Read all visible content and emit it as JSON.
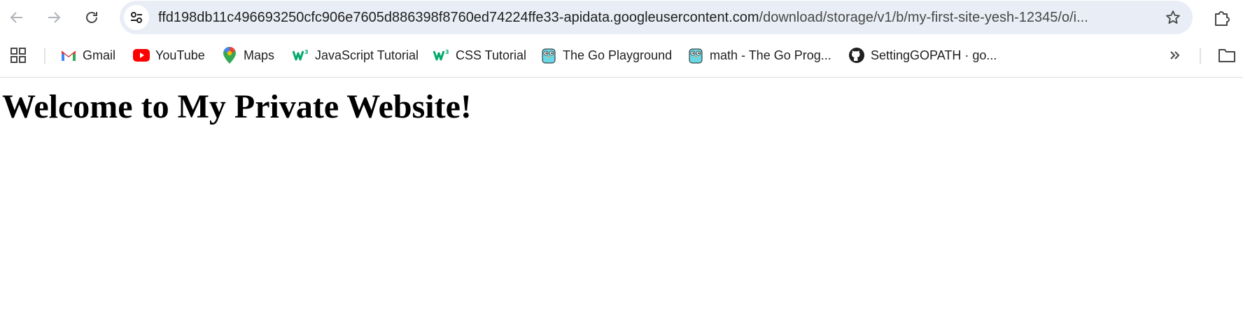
{
  "browser": {
    "url_host": "ffd198db11c496693250cfc906e7605d886398f8760ed74224ffe33-apidata.googleusercontent.com",
    "url_path": "/download/storage/v1/b/my-first-site-yesh-12345/o/i...",
    "icons": {
      "back": "arrow-left",
      "forward": "arrow-right",
      "reload": "reload",
      "site_info": "tune",
      "bookmark": "star",
      "extensions": "puzzle-piece"
    }
  },
  "bookmarks_bar": {
    "items": [
      {
        "label": "Gmail",
        "icon": "gmail"
      },
      {
        "label": "YouTube",
        "icon": "youtube"
      },
      {
        "label": "Maps",
        "icon": "maps-pin"
      },
      {
        "label": "JavaScript Tutorial",
        "icon": "w3schools"
      },
      {
        "label": "CSS Tutorial",
        "icon": "w3schools"
      },
      {
        "label": "The Go Playground",
        "icon": "go-gopher"
      },
      {
        "label": "math - The Go Prog...",
        "icon": "go-gopher"
      },
      {
        "label": "SettingGOPATH · go...",
        "icon": "github"
      }
    ],
    "more_icon": "double-chevron-right",
    "folder_icon": "folder"
  },
  "page": {
    "heading": "Welcome to My Private Website!"
  },
  "colors": {
    "omnibox_bg": "#e9eef6",
    "youtube_red": "#ff0000",
    "w3_green": "#04aa6d",
    "gopher_blue": "#6ad7e5"
  }
}
